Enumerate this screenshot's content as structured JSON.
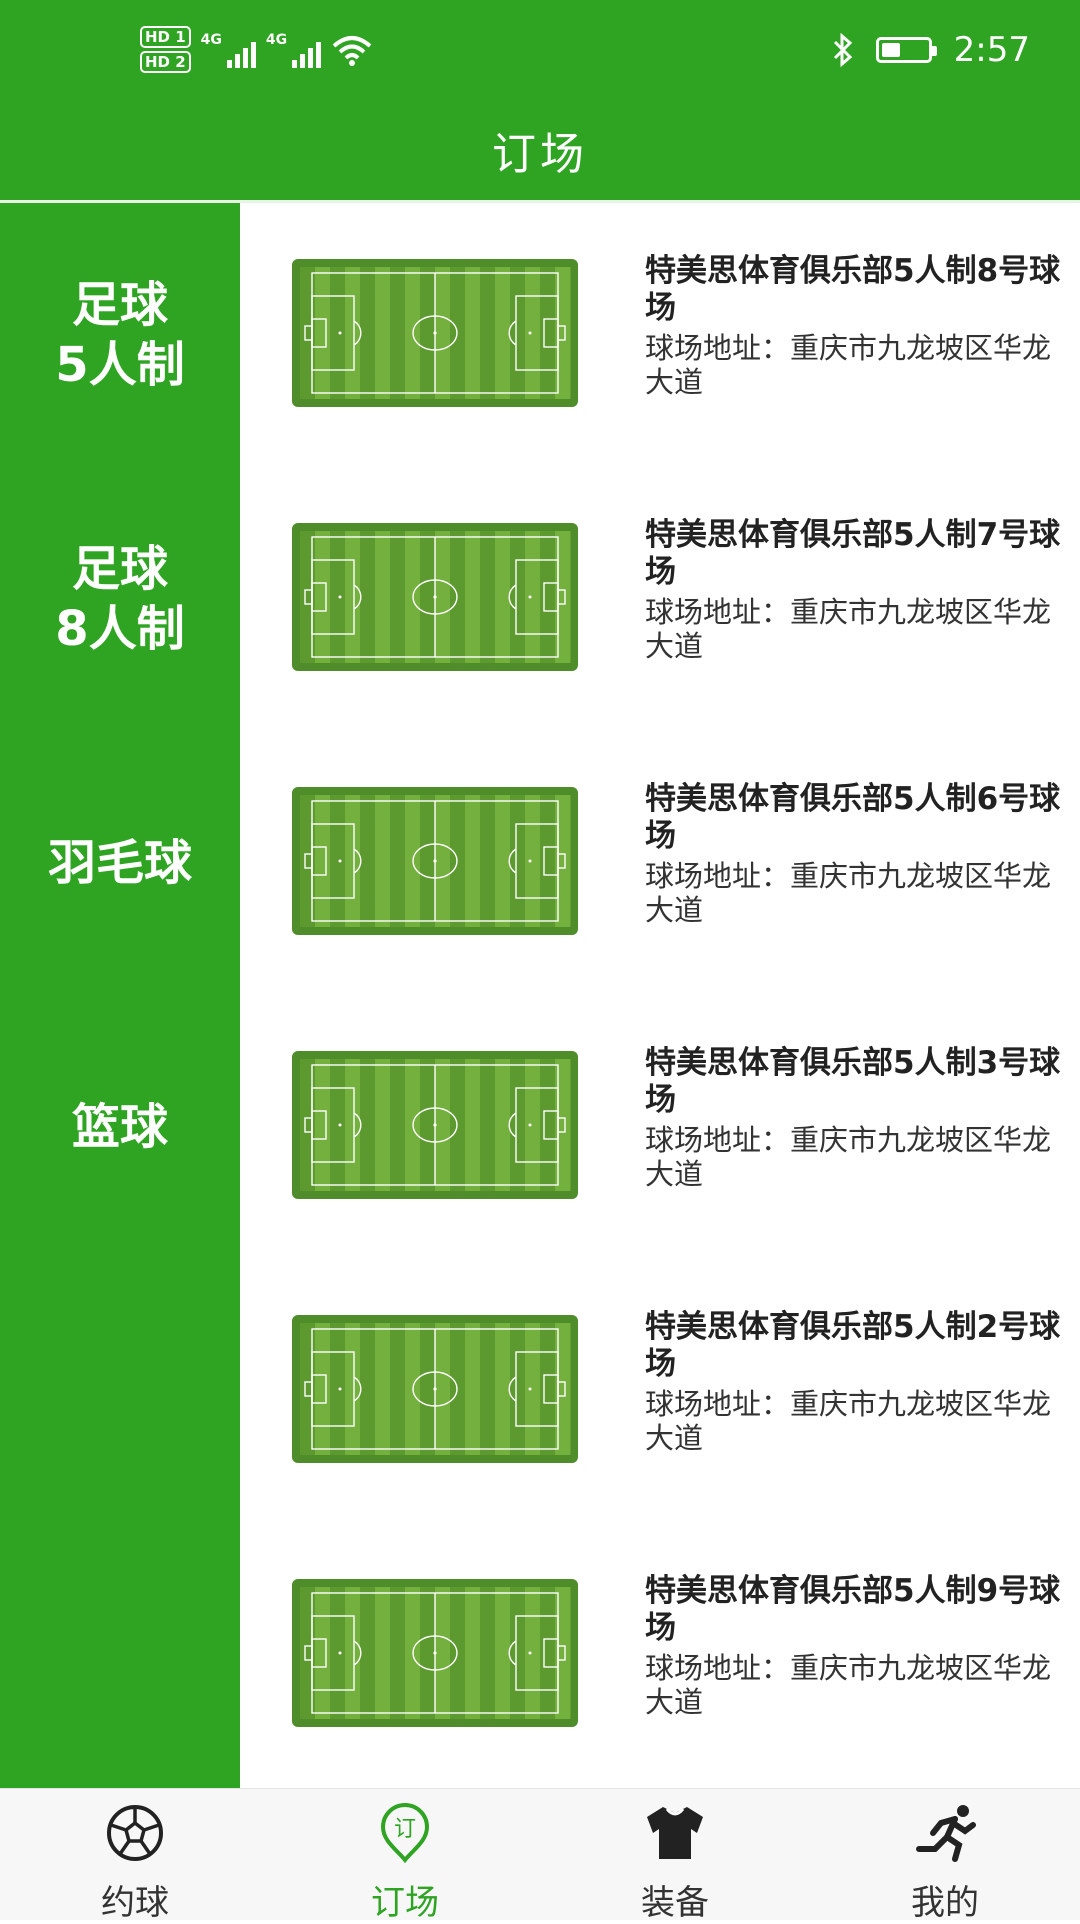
{
  "status_bar": {
    "hd1": "HD 1",
    "hd2": "HD 2",
    "net1": "4G",
    "net2": "4G",
    "time": "2:57"
  },
  "header": {
    "title": "订场"
  },
  "categories": [
    {
      "line1": "足球",
      "line2": "5人制"
    },
    {
      "line1": "足球",
      "line2": "8人制"
    },
    {
      "line1": "羽毛球",
      "line2": ""
    },
    {
      "line1": "篮球",
      "line2": ""
    }
  ],
  "venues": [
    {
      "name": "特美思体育俱乐部5人制8号球场",
      "address": "球场地址：重庆市九龙坡区华龙大道"
    },
    {
      "name": "特美思体育俱乐部5人制7号球场",
      "address": "球场地址：重庆市九龙坡区华龙大道"
    },
    {
      "name": "特美思体育俱乐部5人制6号球场",
      "address": "球场地址：重庆市九龙坡区华龙大道"
    },
    {
      "name": "特美思体育俱乐部5人制3号球场",
      "address": "球场地址：重庆市九龙坡区华龙大道"
    },
    {
      "name": "特美思体育俱乐部5人制2号球场",
      "address": "球场地址：重庆市九龙坡区华龙大道"
    },
    {
      "name": "特美思体育俱乐部5人制9号球场",
      "address": "球场地址：重庆市九龙坡区华龙大道"
    }
  ],
  "tabs": [
    {
      "label": "约球",
      "icon": "soccer-ball-icon"
    },
    {
      "label": "订场",
      "icon": "booking-pin-icon",
      "icon_text": "订"
    },
    {
      "label": "装备",
      "icon": "jersey-icon"
    },
    {
      "label": "我的",
      "icon": "runner-icon"
    }
  ],
  "colors": {
    "primary": "#2ea422",
    "field_dark": "#5c9a2f",
    "field_light": "#74b03e"
  }
}
